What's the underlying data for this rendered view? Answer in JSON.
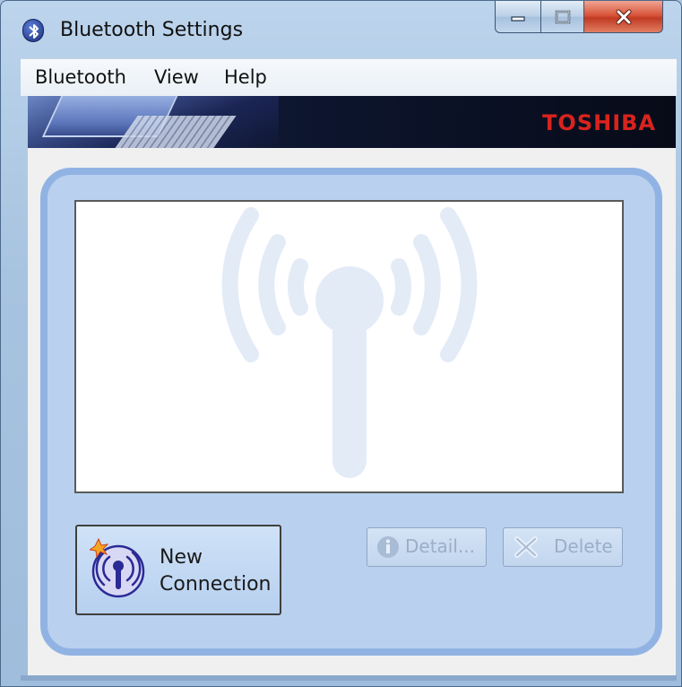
{
  "window": {
    "title": "Bluetooth Settings",
    "buttons": [
      "minimize",
      "maximize",
      "close"
    ]
  },
  "menubar": {
    "items": [
      "Bluetooth",
      "View",
      "Help"
    ]
  },
  "banner": {
    "brand": "TOSHIBA"
  },
  "device_list": {
    "items": []
  },
  "actions": {
    "new_connection_label": "New\nConnection",
    "detail_label": "Detail...",
    "delete_label": "Delete"
  },
  "colors": {
    "accent": "#91b3e3",
    "panel": "#b9d1ef",
    "brand_red": "#d8231e",
    "disabled_text": "#9aaec8"
  },
  "icons": {
    "app": "bluetooth-icon",
    "new_connection": "antenna-star-icon",
    "detail": "info-icon",
    "delete": "x-icon"
  }
}
